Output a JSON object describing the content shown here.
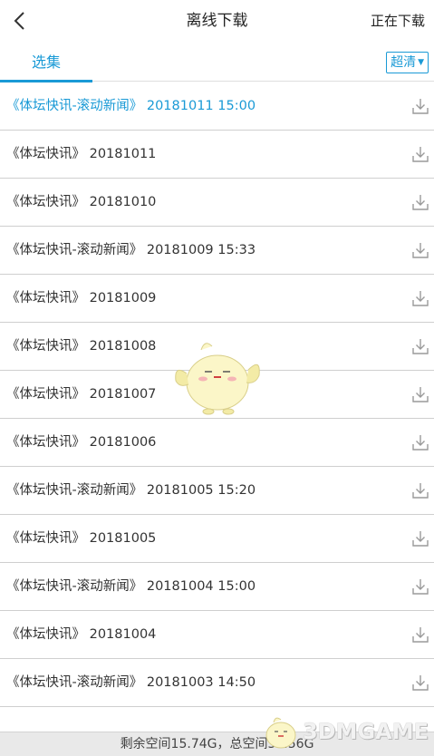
{
  "header": {
    "title": "离线下载",
    "right_action": "正在下载"
  },
  "tabs": {
    "active_tab": "选集",
    "quality": "超清"
  },
  "episodes": [
    {
      "label": "《体坛快讯-滚动新闻》 20181011 15:00",
      "active": true
    },
    {
      "label": "《体坛快讯》 20181011",
      "active": false
    },
    {
      "label": "《体坛快讯》 20181010",
      "active": false
    },
    {
      "label": "《体坛快讯-滚动新闻》 20181009 15:33",
      "active": false
    },
    {
      "label": "《体坛快讯》 20181009",
      "active": false
    },
    {
      "label": "《体坛快讯》 20181008",
      "active": false
    },
    {
      "label": "《体坛快讯》 20181007",
      "active": false
    },
    {
      "label": "《体坛快讯》 20181006",
      "active": false
    },
    {
      "label": "《体坛快讯-滚动新闻》 20181005 15:20",
      "active": false
    },
    {
      "label": "《体坛快讯》 20181005",
      "active": false
    },
    {
      "label": "《体坛快讯-滚动新闻》 20181004 15:00",
      "active": false
    },
    {
      "label": "《体坛快讯》 20181004",
      "active": false
    },
    {
      "label": "《体坛快讯-滚动新闻》 20181003 14:50",
      "active": false
    }
  ],
  "footer": {
    "storage_text": "剩余空间15.74G，总空间31.56G"
  },
  "watermark": {
    "text": "3DMGAME"
  },
  "colors": {
    "accent": "#1a9ad6"
  }
}
